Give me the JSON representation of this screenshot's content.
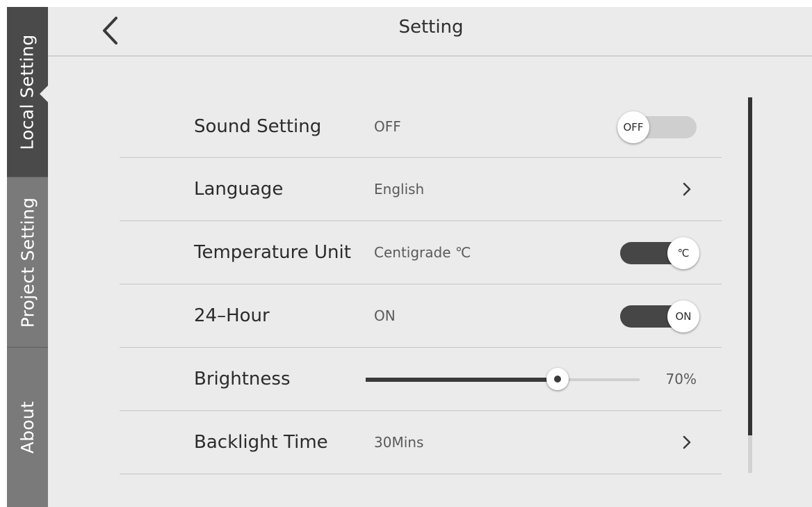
{
  "header": {
    "title": "Setting"
  },
  "sidebar": {
    "tabs": [
      {
        "label": "Local Setting",
        "active": true
      },
      {
        "label": "Project Setting",
        "active": false
      },
      {
        "label": "About",
        "active": false
      }
    ]
  },
  "settings": {
    "sound": {
      "label": "Sound Setting",
      "value": "OFF",
      "toggle_text": "OFF",
      "enabled": false
    },
    "language": {
      "label": "Language",
      "value": "English"
    },
    "temperature": {
      "label": "Temperature Unit",
      "value": "Centigrade ℃",
      "toggle_text": "℃",
      "enabled": true
    },
    "hour24": {
      "label": "24–Hour",
      "value": "ON",
      "toggle_text": "ON",
      "enabled": true
    },
    "brightness": {
      "label": "Brightness",
      "percent": 70,
      "value_text": "70%"
    },
    "backlight": {
      "label": "Backlight Time",
      "value": "30Mins"
    }
  },
  "scrollbar": {
    "visible_fraction": 0.9
  },
  "colors": {
    "background": "#ebebeb",
    "sidebar": "#7a7a7a",
    "sidebar_active": "#4a4a4a",
    "toggle_on": "#464646",
    "toggle_off": "#cfcfcf",
    "text": "#2b2b2b"
  },
  "icons": {
    "back": "chevron-left-icon",
    "row_arrow": "chevron-right-icon"
  }
}
